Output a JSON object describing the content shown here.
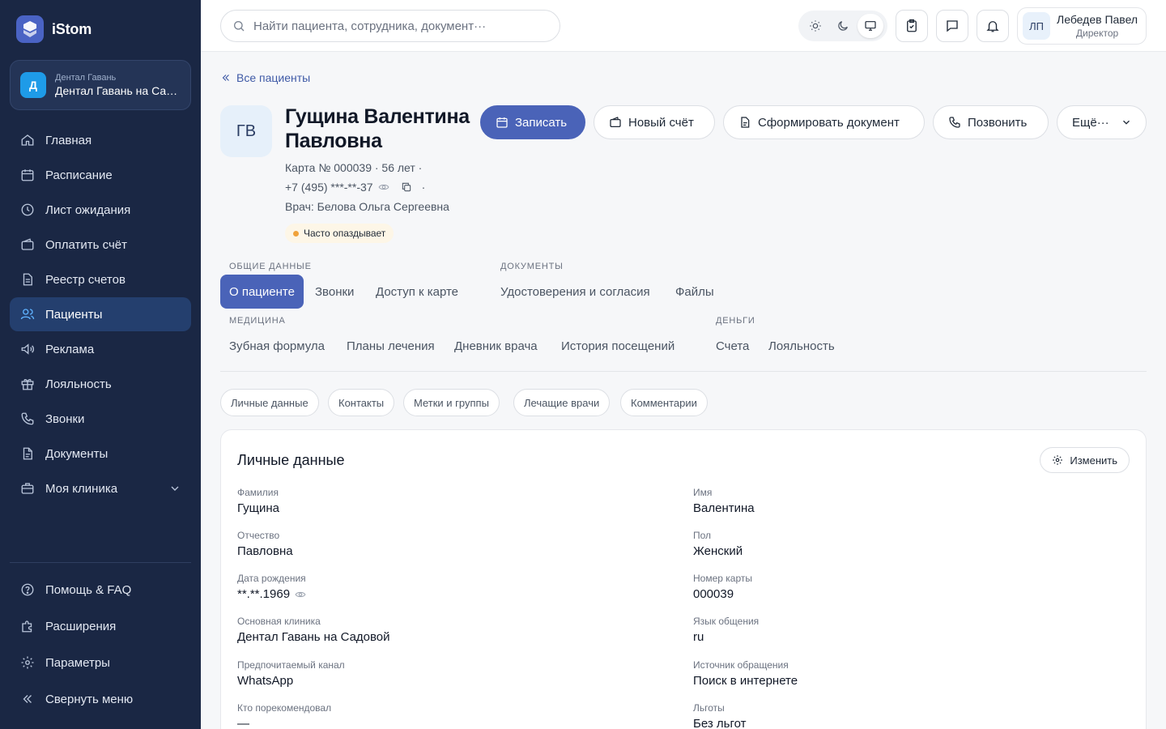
{
  "brand": {
    "name": "iStom"
  },
  "clinic": {
    "avatar": "Д",
    "org": "Дентал Гавань",
    "name": "Дентал Гавань на Садовой"
  },
  "nav": {
    "items": [
      {
        "label": "Главная",
        "icon": "home-icon"
      },
      {
        "label": "Расписание",
        "icon": "calendar-icon"
      },
      {
        "label": "Лист ожидания",
        "icon": "clock-icon"
      },
      {
        "label": "Оплатить счёт",
        "icon": "wallet-icon"
      },
      {
        "label": "Реестр счетов",
        "icon": "document-icon"
      },
      {
        "label": "Пациенты",
        "icon": "users-icon",
        "active": true
      },
      {
        "label": "Реклама",
        "icon": "megaphone-icon"
      },
      {
        "label": "Лояльность",
        "icon": "gift-icon"
      },
      {
        "label": "Звонки",
        "icon": "phone-icon"
      },
      {
        "label": "Документы",
        "icon": "file-icon"
      },
      {
        "label": "Моя клиника",
        "icon": "briefcase-icon"
      }
    ],
    "bottom": [
      {
        "label": "Помощь & FAQ",
        "icon": "help-icon"
      },
      {
        "label": "Расширения",
        "icon": "puzzle-icon"
      },
      {
        "label": "Параметры",
        "icon": "gear-icon"
      },
      {
        "label": "Свернуть меню",
        "icon": "collapse-icon"
      }
    ]
  },
  "topbar": {
    "search_placeholder": "Найти пациента, сотрудника, документ···",
    "user": {
      "initials": "ЛП",
      "name": "Лебедев Павел",
      "role": "Директор"
    }
  },
  "patient": {
    "back_label": "Все пациенты",
    "initials": "ГВ",
    "name": "Гущина Валентина Павловна",
    "card_line": "Карта № 000039 · 56 лет ·",
    "phone": "+7 (495) ***-**-37",
    "phone_sep": "·",
    "doctor_line": "Врач: Белова Ольга Сергеевна",
    "tag": "Часто опаздывает"
  },
  "actions": {
    "book": "Записать",
    "invoice": "Новый счёт",
    "document": "Сформировать документ",
    "call": "Позвонить",
    "more": "Ещё···"
  },
  "tab_groups": {
    "general": {
      "title": "ОБЩИЕ ДАННЫЕ",
      "tabs": [
        "О пациенте",
        "Звонки",
        "Доступ к карте"
      ]
    },
    "documents": {
      "title": "ДОКУМЕНТЫ",
      "tabs": [
        "Удостоверения и согласия",
        "Файлы"
      ]
    },
    "medicine": {
      "title": "МЕДИЦИНА",
      "tabs": [
        "Зубная формула",
        "Планы лечения",
        "Дневник врача",
        "История посещений"
      ]
    },
    "money": {
      "title": "ДЕНЬГИ",
      "tabs": [
        "Счета",
        "Лояльность"
      ]
    }
  },
  "subtabs": [
    "Личные данные",
    "Контакты",
    "Метки и группы",
    "Лечащие врачи",
    "Комментарии"
  ],
  "personal": {
    "title": "Личные данные",
    "edit_label": "Изменить",
    "fields": [
      {
        "label": "Фамилия",
        "value": "Гущина"
      },
      {
        "label": "Имя",
        "value": "Валентина"
      },
      {
        "label": "Отчество",
        "value": "Павловна"
      },
      {
        "label": "Пол",
        "value": "Женский"
      },
      {
        "label": "Дата рождения",
        "value": "**.**.1969"
      },
      {
        "label": "Номер карты",
        "value": "000039"
      },
      {
        "label": "Основная клиника",
        "value": "Дентал Гавань на Садовой"
      },
      {
        "label": "Язык общения",
        "value": "ru"
      },
      {
        "label": "Предпочитаемый канал",
        "value": "WhatsApp"
      },
      {
        "label": "Источник обращения",
        "value": "Поиск в интернете"
      },
      {
        "label": "Кто порекомендовал",
        "value": "—"
      },
      {
        "label": "Льготы",
        "value": "Без льгот"
      }
    ]
  },
  "colors": {
    "sidebar": "#1a2744",
    "accent": "#4a63b8",
    "active_nav": "#243f6e",
    "tag_dot": "#f0a23a"
  }
}
